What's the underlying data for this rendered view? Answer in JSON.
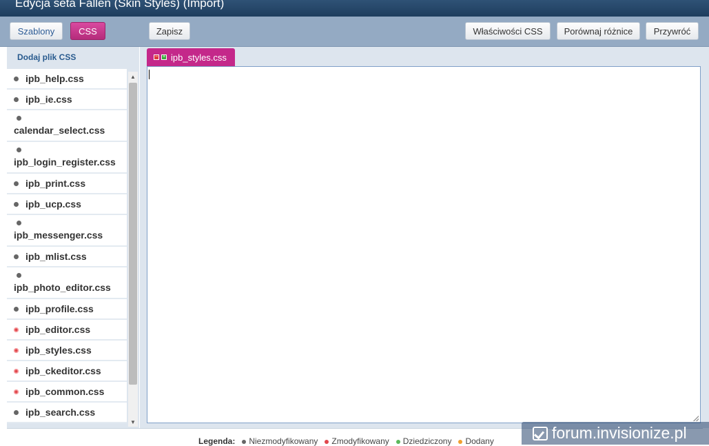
{
  "window": {
    "title": "Edycja seta Fallen (Skin Styles) (Import)"
  },
  "toolbar": {
    "templates_label": "Szablony",
    "css_label": "CSS",
    "save_label": "Zapisz",
    "properties_label": "Właściwości CSS",
    "compare_label": "Porównaj różnice",
    "restore_label": "Przywróć"
  },
  "sidebar": {
    "add_label": "Dodaj plik CSS",
    "files": [
      {
        "name": "ipb_help.css",
        "status": "unmodified"
      },
      {
        "name": "ipb_ie.css",
        "status": "unmodified"
      },
      {
        "name": "calendar_select.css",
        "status": "unmodified"
      },
      {
        "name": "ipb_login_register.css",
        "status": "unmodified"
      },
      {
        "name": "ipb_print.css",
        "status": "unmodified"
      },
      {
        "name": "ipb_ucp.css",
        "status": "unmodified"
      },
      {
        "name": "ipb_messenger.css",
        "status": "unmodified"
      },
      {
        "name": "ipb_mlist.css",
        "status": "unmodified"
      },
      {
        "name": "ipb_photo_editor.css",
        "status": "unmodified"
      },
      {
        "name": "ipb_profile.css",
        "status": "unmodified"
      },
      {
        "name": "ipb_editor.css",
        "status": "modified"
      },
      {
        "name": "ipb_styles.css",
        "status": "modified"
      },
      {
        "name": "ipb_ckeditor.css",
        "status": "modified"
      },
      {
        "name": "ipb_common.css",
        "status": "modified"
      },
      {
        "name": "ipb_search.css",
        "status": "unmodified"
      }
    ]
  },
  "editor": {
    "tab_label": "ipb_styles.css",
    "content": ""
  },
  "legend": {
    "title": "Legenda:",
    "items": [
      {
        "label": "Niezmodyfikowany",
        "color": "#666666"
      },
      {
        "label": "Zmodyfikowany",
        "color": "#e0474c"
      },
      {
        "label": "Dziedziczony",
        "color": "#5cb85c"
      },
      {
        "label": "Dodany",
        "color": "#f0a030"
      }
    ]
  },
  "watermark": {
    "text": "forum.invisionize.pl"
  },
  "colors": {
    "accent": "#c4288a",
    "header": "#2a4a6e",
    "toolbar": "#94aac3"
  }
}
